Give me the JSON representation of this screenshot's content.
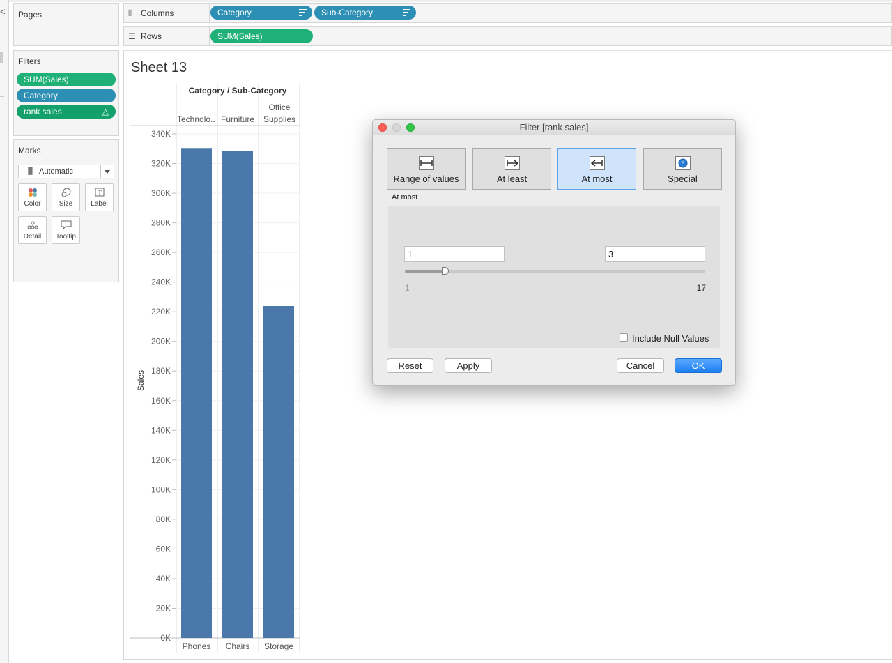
{
  "side": {
    "pages_title": "Pages",
    "filters_title": "Filters",
    "filters": [
      "SUM(Sales)",
      "Category",
      "rank sales"
    ],
    "filter_delta_icon": "△",
    "marks_title": "Marks",
    "marks_type": "Automatic",
    "mark_buttons": [
      "Color",
      "Size",
      "Label",
      "Detail",
      "Tooltip"
    ]
  },
  "shelves": {
    "columns_label": "Columns",
    "columns_pills": [
      "Category",
      "Sub-Category"
    ],
    "rows_label": "Rows",
    "rows_pills": [
      "SUM(Sales)"
    ]
  },
  "sheet": {
    "title": "Sheet 13",
    "header_title": "Category / Sub-Category",
    "categories": [
      "Technolo..",
      "Furniture",
      "Office Supplies"
    ],
    "subcategories": [
      "Phones",
      "Chairs",
      "Storage"
    ]
  },
  "chart_data": {
    "type": "bar",
    "title": "Sheet 13",
    "xlabel": "Category / Sub-Category",
    "ylabel": "Sales",
    "categories": [
      "Phones",
      "Chairs",
      "Storage"
    ],
    "groups": [
      "Technolo..",
      "Furniture",
      "Office Supplies"
    ],
    "values": [
      330007,
      328449,
      223844
    ],
    "ylim": [
      0,
      340000
    ],
    "yticks": [
      "0K",
      "20K",
      "40K",
      "60K",
      "80K",
      "100K",
      "120K",
      "140K",
      "160K",
      "180K",
      "200K",
      "220K",
      "240K",
      "260K",
      "280K",
      "300K",
      "320K",
      "340K"
    ],
    "bar_color": "#4a78aa",
    "grid": true
  },
  "dialog": {
    "title": "Filter [rank sales]",
    "tabs": [
      "Range of values",
      "At least",
      "At most",
      "Special"
    ],
    "active_tab": "At most",
    "section_label": "At most",
    "min_placeholder": "1",
    "max_value": "3",
    "range_min": "1",
    "range_max": "17",
    "slider_fraction": 0.125,
    "include_null_label": "Include Null Values",
    "include_null_checked": false,
    "buttons": {
      "reset": "Reset",
      "apply": "Apply",
      "cancel": "Cancel",
      "ok": "OK"
    }
  }
}
